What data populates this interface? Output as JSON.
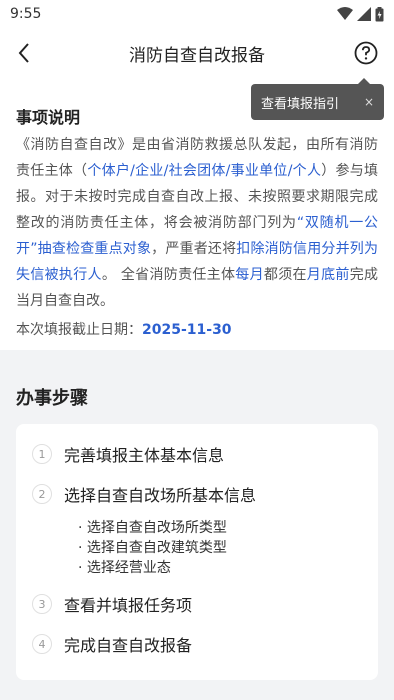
{
  "status": {
    "time": "9:55"
  },
  "nav": {
    "title": "消防自查自改报备"
  },
  "tooltip": {
    "text": "查看填报指引",
    "close": "×"
  },
  "notice": {
    "title": "事项说明",
    "body": {
      "p1": "《消防自查自改》是由省消防救援总队发起，由所有消防责任主体（",
      "h1": "个体户/企业/社会团体/事业单位/个人",
      "p2": "）参与填报。对于未按时完成自查自改上报、未按照要求期限完成整改的消防责任主体，将会被消防部门列为",
      "h2": "“双随机一公开”抽查检查重点对象",
      "p3": "，严重者还将",
      "h3": "扣除消防信用分并列为失信被执行人",
      "p4": "。 全省消防责任主体",
      "h4": "每月",
      "p5": "都须在",
      "h5": "月底前",
      "p6": "完成当月自查自改。"
    },
    "deadline_label": "本次填报截止日期：",
    "deadline_value": "2025-11-30"
  },
  "steps": {
    "title": "办事步骤",
    "items": [
      {
        "num": "1",
        "label": "完善填报主体基本信息"
      },
      {
        "num": "2",
        "label": "选择自查自改场所基本信息"
      },
      {
        "num": "3",
        "label": "查看并填报任务项"
      },
      {
        "num": "4",
        "label": "完成自查自改报备"
      }
    ],
    "sub_items": [
      "· 选择自查自改场所类型",
      "· 选择自查自改建筑类型",
      "· 选择经营业态"
    ]
  }
}
